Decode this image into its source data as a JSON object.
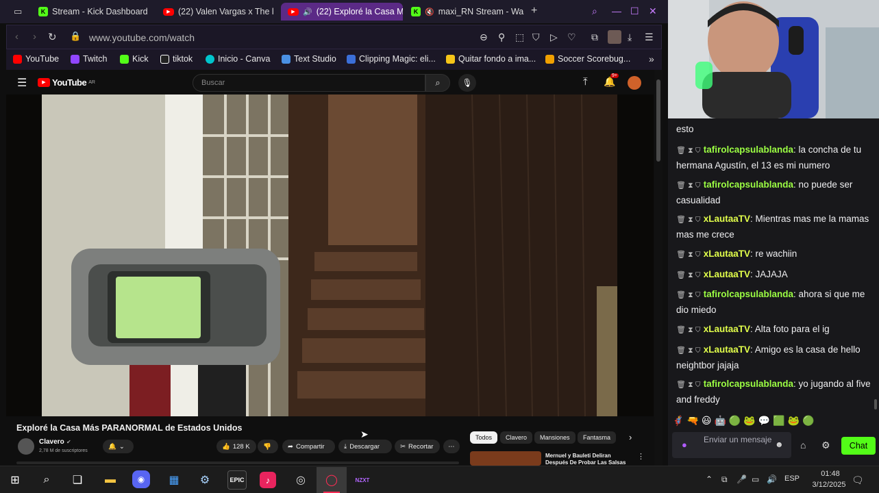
{
  "browser": {
    "tabs": [
      {
        "label": "Stream - Kick Dashboard",
        "icon": "kick-icon"
      },
      {
        "label": "(22) Valen Vargas x The l",
        "icon": "youtube-icon"
      },
      {
        "label": "(22) Exploré la Casa M",
        "icon": "youtube-icon",
        "active": true
      },
      {
        "label": "maxi_RN Stream - Wa",
        "icon": "kick-icon"
      }
    ],
    "new_tab": "+",
    "url": "www.youtube.com/watch",
    "bookmarks": [
      {
        "label": "YouTube",
        "color": "#ff0000"
      },
      {
        "label": "Twitch",
        "color": "#9146ff"
      },
      {
        "label": "Kick",
        "color": "#53fc18"
      },
      {
        "label": "tiktok",
        "color": "#ffffff"
      },
      {
        "label": "Inicio - Canva",
        "color": "#00c4cc"
      },
      {
        "label": "Text Studio",
        "color": "#4a90e2"
      },
      {
        "label": "Clipping Magic: eli...",
        "color": "#3b6fd8"
      },
      {
        "label": "Quitar fondo a ima...",
        "color": "#f5c518"
      },
      {
        "label": "Soccer Scorebug...",
        "color": "#f0a000"
      }
    ]
  },
  "youtube": {
    "logo": "YouTube",
    "logo_sup": "AR",
    "search_placeholder": "Buscar",
    "notifications_count": "9+",
    "video_title": "Exploré la Casa Más PARANORMAL de Estados Unidos",
    "channel": {
      "name": "Clavero",
      "subscribers": "2,78 M de suscriptores"
    },
    "actions": {
      "likes": "128 K",
      "share": "Compartir",
      "download": "Descargar",
      "clip": "Recortar"
    },
    "chips": [
      "Todos",
      "Clavero",
      "Mansiones",
      "Fantasma"
    ],
    "recommended": {
      "title": "Mernuel y Bauleti Deliran Después De Probar Las Salsas"
    }
  },
  "chat": {
    "messages": [
      {
        "user": "",
        "text": "esto",
        "color": "#efeff1"
      },
      {
        "user": "tafirolcapsulablanda",
        "text": "la concha de tu hermana Agustín, el 13 es mi numero",
        "color": "#9cff43"
      },
      {
        "user": "tafirolcapsulablanda",
        "text": "no puede ser casualidad",
        "color": "#9cff43"
      },
      {
        "user": "xLautaaTV",
        "text": "Mientras mas me la mamas mas me crece",
        "color": "#e2ff4b"
      },
      {
        "user": "xLautaaTV",
        "text": "re wachiin",
        "color": "#e2ff4b"
      },
      {
        "user": "xLautaaTV",
        "text": "JAJAJA",
        "color": "#e2ff4b"
      },
      {
        "user": "tafirolcapsulablanda",
        "text": "ahora si que me dio miedo",
        "color": "#9cff43"
      },
      {
        "user": "xLautaaTV",
        "text": "Alta foto para el ig",
        "color": "#e2ff4b"
      },
      {
        "user": "xLautaaTV",
        "text": "Amigo es la casa de hello neightbor jajaja",
        "color": "#e2ff4b"
      },
      {
        "user": "tafirolcapsulablanda",
        "text": "yo jugando al five and freddy",
        "color": "#9cff43"
      }
    ],
    "input_placeholder": "Enviar un mensaje",
    "send_label": "Chat"
  },
  "taskbar": {
    "apps": [
      "windows-start-icon",
      "search-icon",
      "task-view-icon",
      "file-explorer-icon",
      "discord-icon",
      "store-icon",
      "steam-icon",
      "epic-games-icon",
      "tiktok-icon",
      "obs-icon",
      "opera-gx-icon",
      "nzxt-icon"
    ],
    "nzxt_label": "NZXT",
    "epic_label": "EPIC",
    "language": "ESP",
    "time": "01:48",
    "date": "3/12/2025"
  }
}
